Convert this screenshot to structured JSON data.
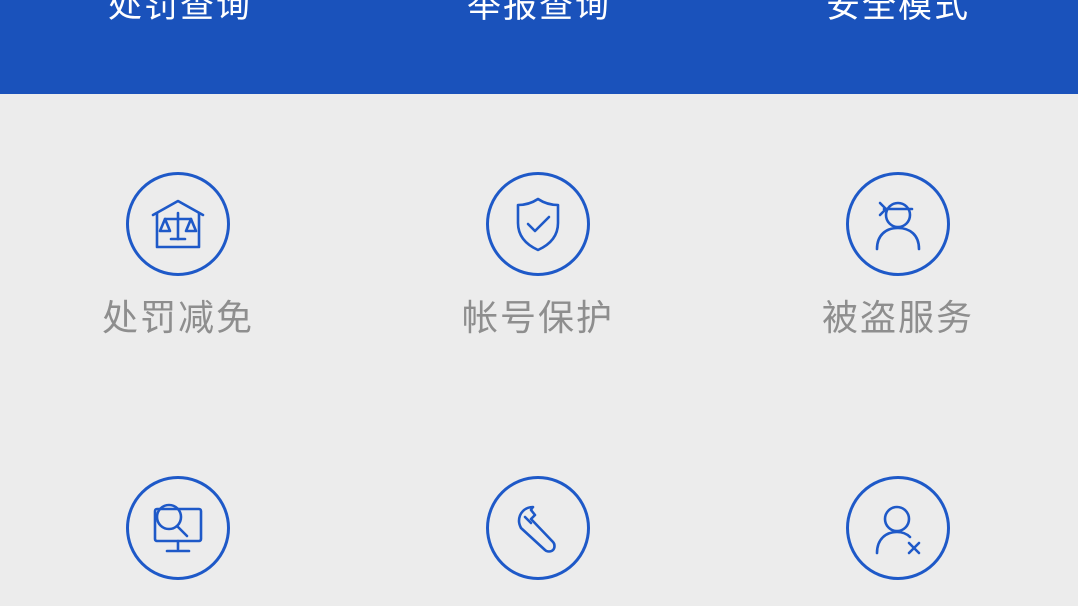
{
  "top_tabs": [
    {
      "label": "处罚查询"
    },
    {
      "label": "举报查询"
    },
    {
      "label": "安全模式"
    }
  ],
  "grid": [
    {
      "label": "处罚减免",
      "icon": "courthouse-scales-icon"
    },
    {
      "label": "帐号保护",
      "icon": "shield-check-icon"
    },
    {
      "label": "被盗服务",
      "icon": "bandit-person-icon"
    },
    {
      "label": "",
      "icon": "monitor-search-icon"
    },
    {
      "label": "",
      "icon": "wrench-icon"
    },
    {
      "label": "",
      "icon": "person-remove-icon"
    }
  ],
  "colors": {
    "accent": "#1a52bb",
    "icon_stroke": "#1e59c8",
    "label": "#8e8e8e",
    "background": "#ececec"
  }
}
